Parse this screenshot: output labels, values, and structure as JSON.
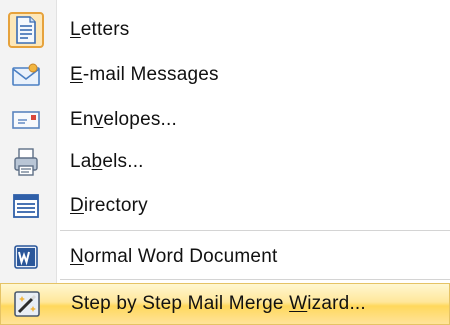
{
  "menu": {
    "items": [
      {
        "label_before": "",
        "label_access": "L",
        "label_after": "etters",
        "icon": "letter-document-icon"
      },
      {
        "label_before": "",
        "label_access": "E",
        "label_after": "-mail Messages",
        "icon": "email-envelope-icon"
      },
      {
        "label_before": "En",
        "label_access": "v",
        "label_after": "elopes...",
        "icon": "envelope-icon"
      },
      {
        "label_before": "La",
        "label_access": "b",
        "label_after": "els...",
        "icon": "labels-icon"
      },
      {
        "label_before": "",
        "label_access": "D",
        "label_after": "irectory",
        "icon": "directory-list-icon"
      },
      {
        "label_before": "",
        "label_access": "N",
        "label_after": "ormal Word Document",
        "icon": "word-document-icon"
      },
      {
        "label_before": "Step by Step Mail Merge ",
        "label_access": "W",
        "label_after": "izard...",
        "icon": "mail-merge-wizard-icon"
      }
    ]
  }
}
